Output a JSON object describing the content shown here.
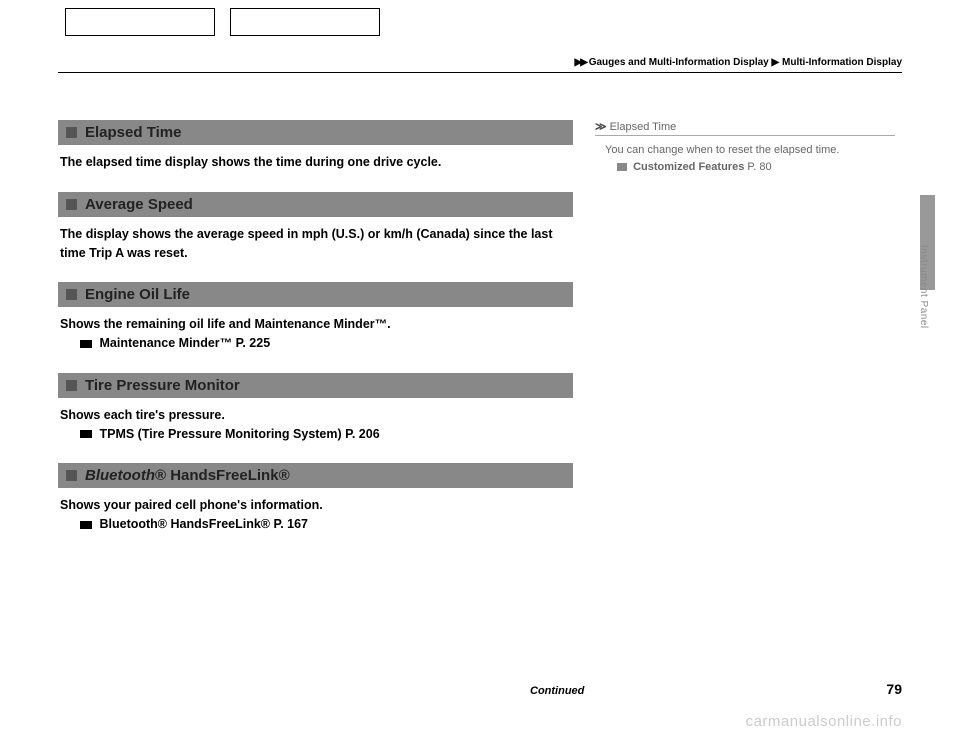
{
  "breadcrumb": {
    "arrows": "▶▶",
    "path1": "Gauges and Multi-Information Display",
    "sep": "▶",
    "path2": "Multi-Information Display"
  },
  "sections": [
    {
      "title": "Elapsed Time",
      "body": "The elapsed time display shows the time during one drive cycle.",
      "ref": null
    },
    {
      "title": "Average Speed",
      "body": "The display shows the average speed in mph (U.S.) or km/h (Canada) since the last time Trip A was reset.",
      "ref": null
    },
    {
      "title": "Engine Oil Life",
      "body": "Shows the remaining oil life and Maintenance Minder™.",
      "ref": "Maintenance Minder™ P. 225"
    },
    {
      "title": "Tire Pressure Monitor",
      "body": "Shows each tire's pressure.",
      "ref": "TPMS (Tire Pressure Monitoring System) P. 206"
    },
    {
      "title": "Bluetooth® HandsFreeLink®",
      "body": "Shows your paired cell phone's information.",
      "ref": "Bluetooth® HandsFreeLink® P. 167",
      "title_prefix_italic": "Bluetooth"
    }
  ],
  "sidebar": {
    "header_arrow": "≫",
    "header_title": "Elapsed Time",
    "text": "You can change when to reset the elapsed time.",
    "ref_label": "Customized Features",
    "ref_page": "P. 80"
  },
  "vertical_label": "Instrument Panel",
  "continued": "Continued",
  "page_num": "79",
  "watermark": "carmanualsonline.info"
}
